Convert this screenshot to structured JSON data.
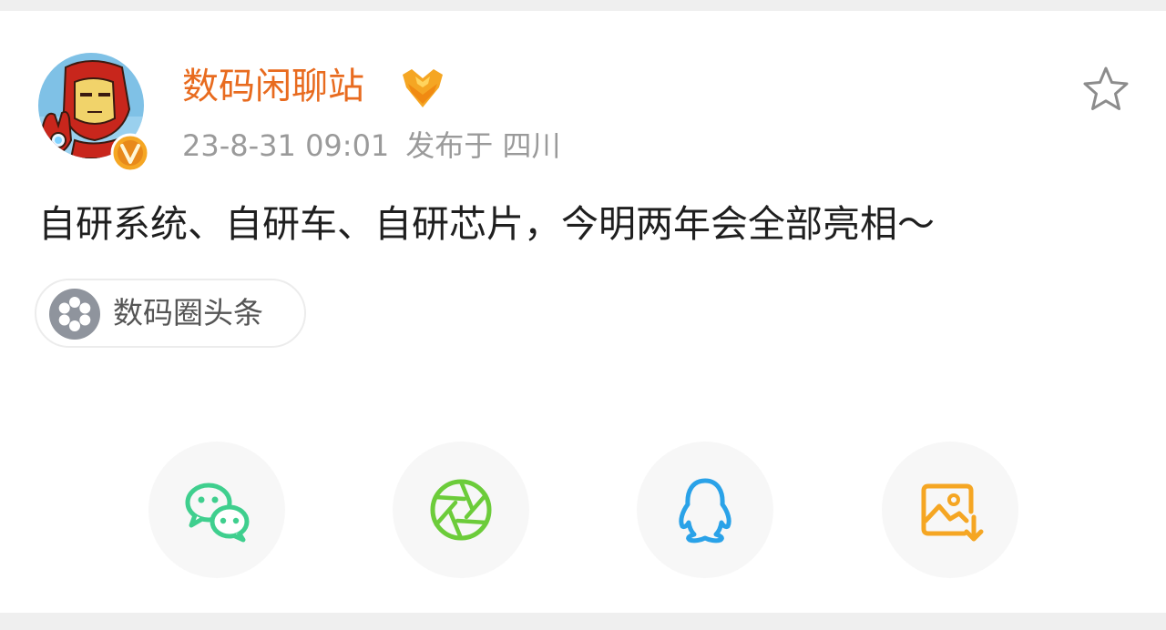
{
  "post": {
    "author_name": "数码闲聊站",
    "time": "23-8-31 09:01",
    "location_text": "发布于 四川",
    "content": "自研系统、自研车、自研芯片，今明两年会全部亮相～",
    "topic_label": "数码圈头条"
  },
  "icons": {
    "avatar": "iron-man-avatar",
    "verified": "verified-v-badge-icon",
    "medal": "medal-icon",
    "favorite": "star-outline-icon",
    "topic": "topic-icon",
    "share": [
      "wechat-icon",
      "moments-icon",
      "qq-icon",
      "save-image-icon"
    ]
  },
  "colors": {
    "author_name": "#e86b1f",
    "wechat": "#3fcf8e",
    "moments": "#6ccc3a",
    "qq": "#2aa2e8",
    "save_image": "#f5a623"
  }
}
